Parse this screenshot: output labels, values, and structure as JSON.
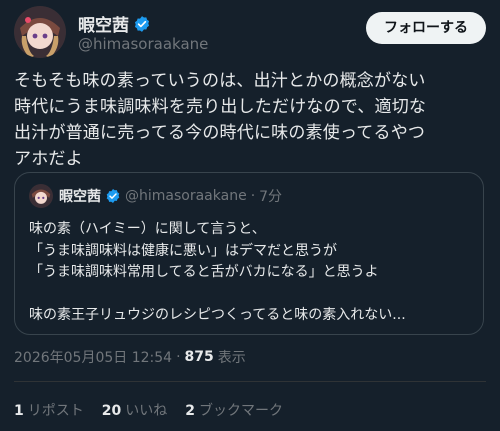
{
  "tweet": {
    "author": {
      "name": "暇空茜",
      "handle": "@himasoraakane"
    },
    "follow_label": "フォローする",
    "text": "そもそも味の素っていうのは、出汁とかの概念がない\n時代にうま味調味料を売り出しただけなので、適切な\n出汁が普通に売ってる今の時代に味の素使ってるやつ\nアホだよ",
    "quote": {
      "author": {
        "name": "暇空茜",
        "handle": "@himasoraakane",
        "age": "7分"
      },
      "separator": "·",
      "text": "味の素（ハイミー）に関して言うと、\n「うま味調味料は健康に悪い」はデマだと思うが\n「うま味調味料常用してると舌がバカになる」と思うよ\n\n味の素王子リュウジのレシピつくってると味の素入れない..."
    },
    "timestamp": "2026年05月05日 12:54",
    "meta_separator": "·",
    "views": {
      "count": "875",
      "label": "表示"
    },
    "stats": {
      "reposts": {
        "count": "1",
        "label": "リポスト"
      },
      "likes": {
        "count": "20",
        "label": "いいね"
      },
      "bookmarks": {
        "count": "2",
        "label": "ブックマーク"
      }
    },
    "colors": {
      "background": "#15202b",
      "verified": "#1d9bf0",
      "follow_bg": "#eff3f4"
    }
  }
}
